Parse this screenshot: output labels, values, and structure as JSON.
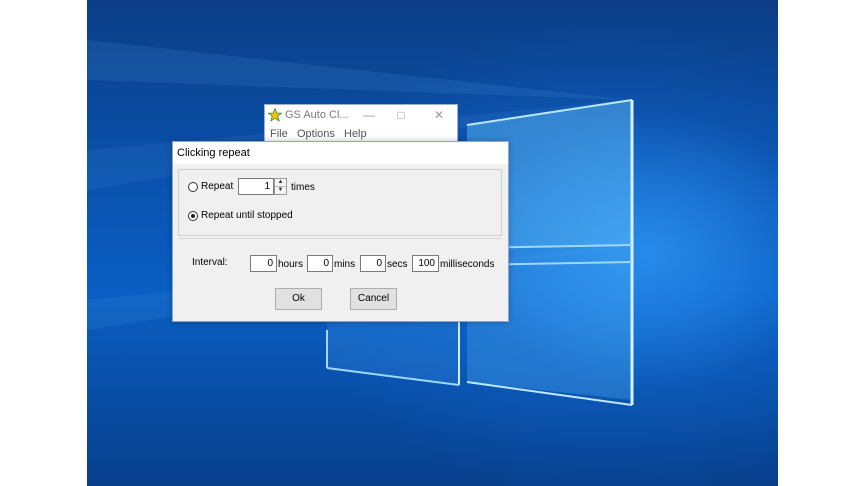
{
  "app_window": {
    "title": "GS Auto Cl...",
    "minimize_glyph": "—",
    "maximize_glyph": "□",
    "close_glyph": "✕",
    "menu": [
      "File",
      "Options",
      "Help"
    ]
  },
  "dialog": {
    "title": "Clicking repeat",
    "repeat_label": "Repeat",
    "repeat_count": "1",
    "times_label": "times",
    "repeat_until_stopped_label": "Repeat until stopped",
    "selected_option": "repeat_until_stopped",
    "interval_label": "Interval:",
    "hours_value": "0",
    "hours_label": "hours",
    "mins_value": "0",
    "mins_label": "mins",
    "secs_value": "0",
    "secs_label": "secs",
    "ms_value": "100",
    "ms_label": "milliseconds",
    "ok_label": "Ok",
    "cancel_label": "Cancel"
  },
  "icons": {
    "app": "star-icon",
    "spin_up": "spin-up-icon",
    "spin_down": "spin-down-icon"
  },
  "colors": {
    "wallpaper": "#0a56b6",
    "dialog_bg": "#f0f0f0",
    "button_bg": "#e1e1e1"
  }
}
